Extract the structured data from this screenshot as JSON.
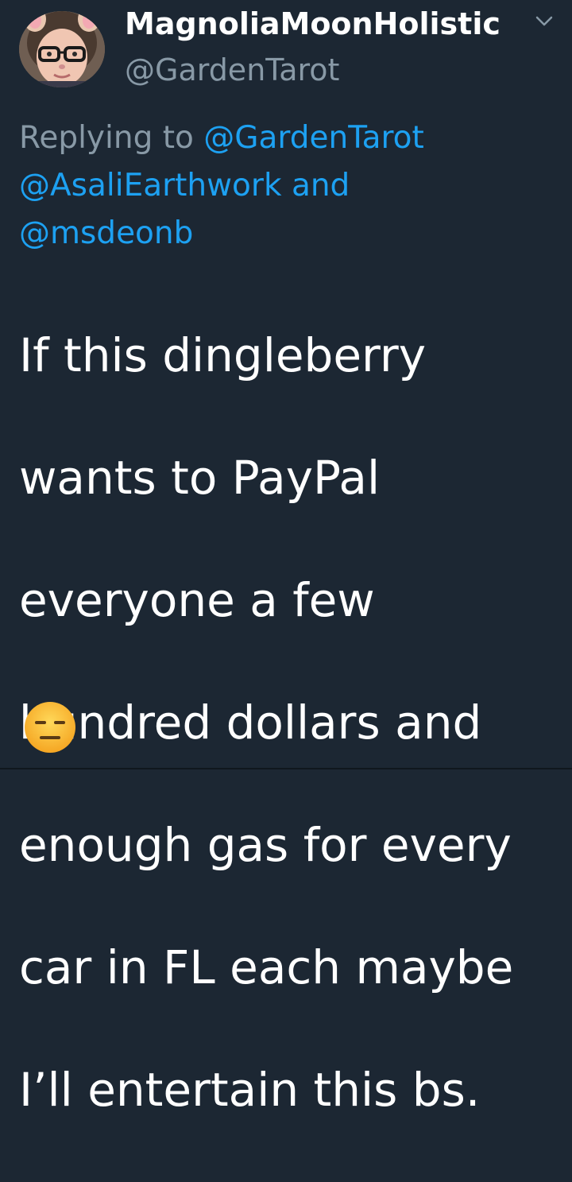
{
  "tweet": {
    "display_name": "MagnoliaMoonHolistic",
    "handle": "@GardenTarot",
    "menu_icon": "chevron-down-icon",
    "reply": {
      "prefix": "Replying to",
      "mention_1": "@GardenTarot",
      "mention_2": "@AsaliEarthwork",
      "conjunction": "and",
      "mention_3": "@msdeonb"
    },
    "body_lines": [
      "If this dingleberry",
      "wants to PayPal",
      "everyone a few",
      "hundred dollars and",
      "enough gas for every",
      "car in FL each maybe",
      "I’ll entertain this bs."
    ],
    "emoji": "expressionless-face-emoji"
  },
  "colors": {
    "background": "#1c2733",
    "text": "#ffffff",
    "secondary": "#8899a6",
    "link": "#1da1f2"
  }
}
